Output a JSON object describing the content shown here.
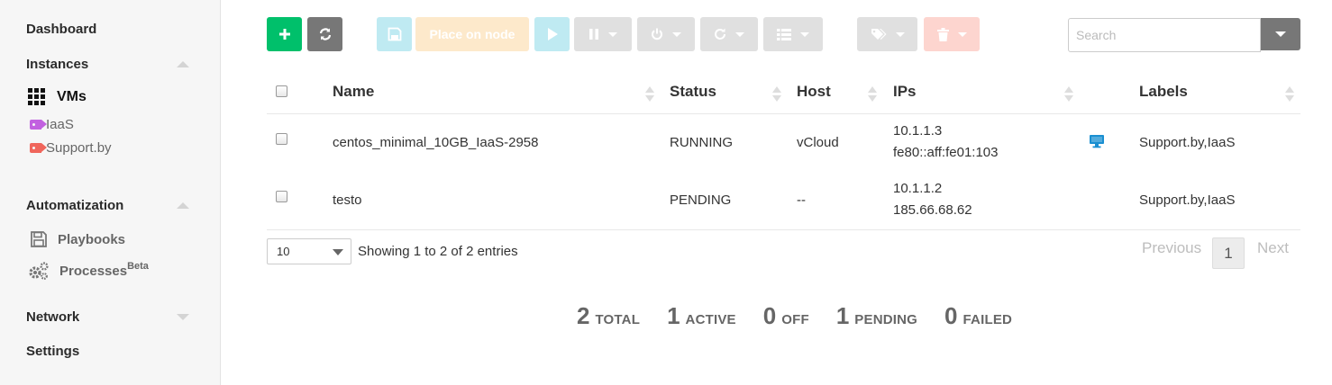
{
  "sidebar": {
    "dashboard": "Dashboard",
    "instances": "Instances",
    "vms": "VMs",
    "tags": [
      {
        "label": "IaaS",
        "color": "#c261e0"
      },
      {
        "label": "Support.by",
        "color": "#f0665c"
      }
    ],
    "automatization": "Automatization",
    "playbooks": "Playbooks",
    "processes": "Processes",
    "processes_sup": "Beta",
    "network": "Network",
    "settings": "Settings"
  },
  "toolbar": {
    "add_color": "#00c06b",
    "refresh_color": "#777777",
    "save_color": "#bfeaf2",
    "place_on_node_label": "Place on node",
    "place_on_node_color": "#fde9cb",
    "play_color": "#bfeaf2",
    "grey_disabled_color": "#e0e0e0",
    "delete_color": "#fdd5cf"
  },
  "search": {
    "placeholder": "Search",
    "value": ""
  },
  "table": {
    "columns": [
      "Name",
      "Status",
      "Host",
      "IPs",
      "Labels"
    ],
    "rows": [
      {
        "name": "centos_minimal_10GB_IaaS-2958",
        "status": "RUNNING",
        "host": "vCloud",
        "ips": [
          "10.1.1.3",
          "fe80::aff:fe01:103"
        ],
        "has_vnc": true,
        "labels": "Support.by,IaaS"
      },
      {
        "name": "testo",
        "status": "PENDING",
        "host": "--",
        "ips": [
          "10.1.1.2",
          "185.66.68.62"
        ],
        "has_vnc": false,
        "labels": "Support.by,IaaS"
      }
    ]
  },
  "footer": {
    "page_length": "10",
    "info": "Showing 1 to 2 of 2 entries",
    "previous": "Previous",
    "current_page": "1",
    "next": "Next"
  },
  "summary": [
    {
      "count": "2",
      "label": "TOTAL"
    },
    {
      "count": "1",
      "label": "ACTIVE"
    },
    {
      "count": "0",
      "label": "OFF"
    },
    {
      "count": "1",
      "label": "PENDING"
    },
    {
      "count": "0",
      "label": "FAILED"
    }
  ],
  "colors": {
    "vnc_icon": "#1a8fd1"
  }
}
